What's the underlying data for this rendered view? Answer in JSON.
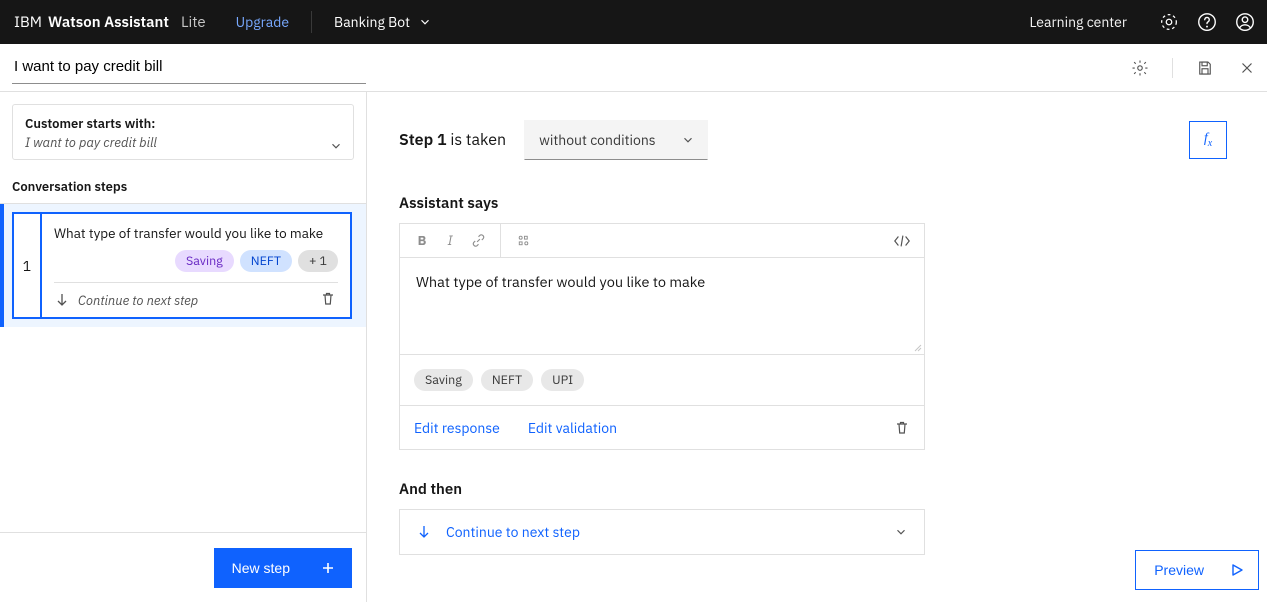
{
  "header": {
    "brand_prefix": "IBM",
    "brand_product": "Watson Assistant",
    "plan": "Lite",
    "upgrade": "Upgrade",
    "bot_name": "Banking Bot",
    "learning_center": "Learning center"
  },
  "action_title": "I want to pay credit bill",
  "sidebar": {
    "customer_starts_lbl": "Customer starts with:",
    "customer_starts_example": "I want to pay credit bill",
    "section_lbl": "Conversation steps",
    "steps": [
      {
        "num": "1",
        "question": "What type of transfer would you like to make",
        "pills": [
          "Saving",
          "NEFT",
          "+ 1"
        ],
        "continue_lbl": "Continue to next step"
      }
    ],
    "new_step_btn": "New step"
  },
  "main": {
    "step_label_prefix": "Step 1",
    "step_label_suffix": " is taken",
    "condition_select": "without conditions",
    "fx_label": "fx",
    "assistant_says_lbl": "Assistant says",
    "editor_text": "What type of transfer would you like to make",
    "options": [
      "Saving",
      "NEFT",
      "UPI"
    ],
    "edit_response": "Edit response",
    "edit_validation": "Edit validation",
    "and_then_lbl": "And then",
    "and_then_select": "Continue to next step",
    "preview_btn": "Preview"
  }
}
